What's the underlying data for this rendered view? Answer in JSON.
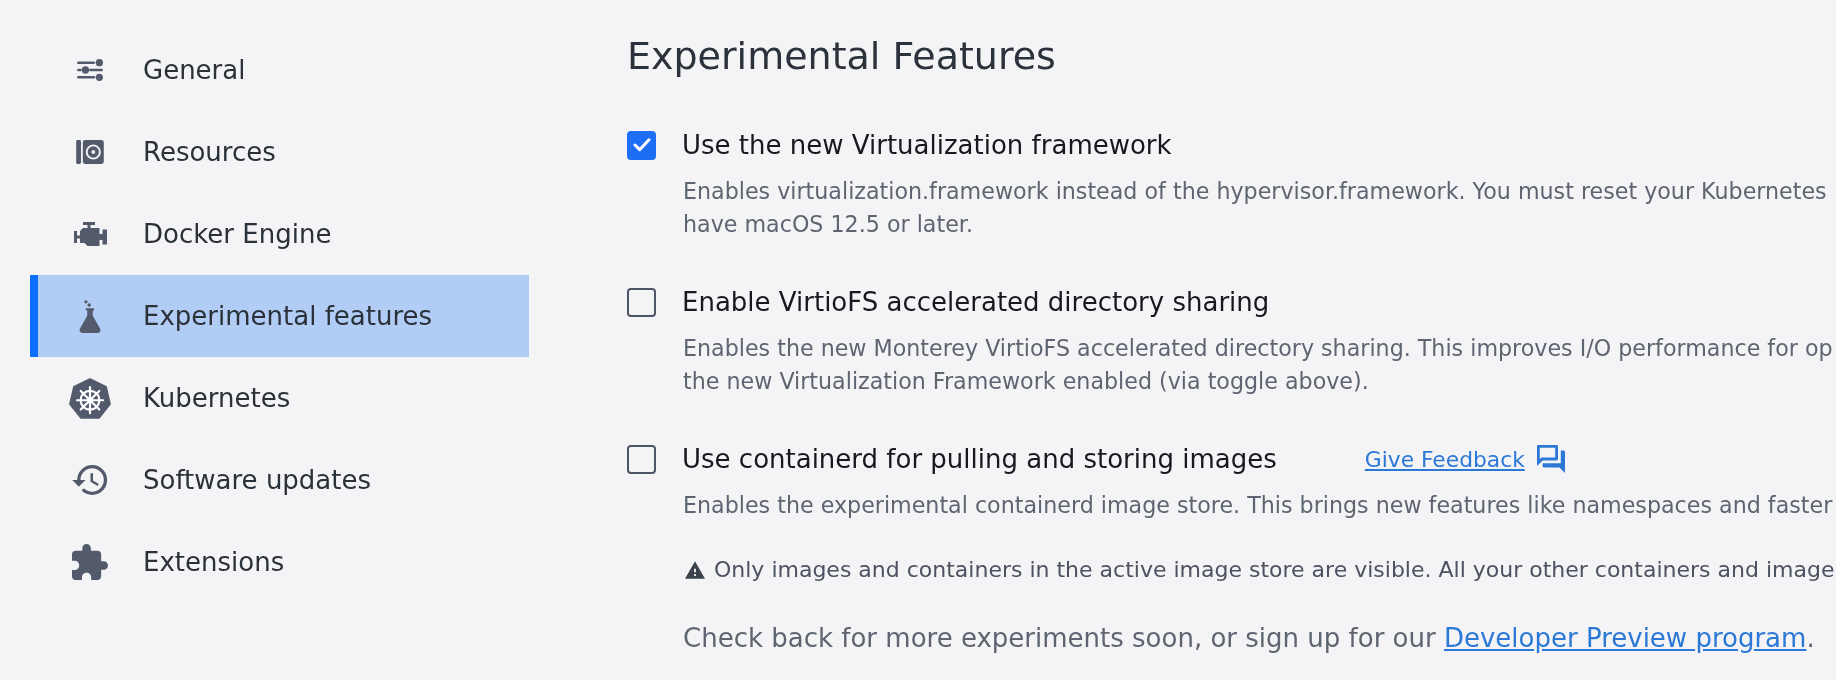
{
  "sidebar": {
    "items": [
      {
        "label": "General",
        "selected": false
      },
      {
        "label": "Resources",
        "selected": false
      },
      {
        "label": "Docker Engine",
        "selected": false
      },
      {
        "label": "Experimental features",
        "selected": true
      },
      {
        "label": "Kubernetes",
        "selected": false
      },
      {
        "label": "Software updates",
        "selected": false
      },
      {
        "label": "Extensions",
        "selected": false
      }
    ]
  },
  "main": {
    "title": "Experimental Features",
    "features": [
      {
        "label": "Use the new Virtualization framework",
        "checked": true,
        "description": [
          "Enables virtualization.framework instead of the hypervisor.framework. You must reset your Kubernetes",
          "have macOS 12.5 or later."
        ]
      },
      {
        "label": "Enable VirtioFS accelerated directory sharing",
        "checked": false,
        "description": [
          "Enables the new Monterey VirtioFS accelerated directory sharing. This improves I/O performance for op",
          "the new Virtualization Framework enabled (via toggle above)."
        ]
      },
      {
        "label": "Use containerd for pulling and storing images",
        "checked": false,
        "feedback_link": "Give Feedback",
        "description": [
          "Enables the experimental containerd image store. This brings new features like namespaces and faster"
        ],
        "warning": "Only images and containers in the active image store are visible. All your other containers and image"
      }
    ],
    "footer": {
      "text": "Check back for more experiments soon, or sign up for our",
      "link": "Developer Preview program",
      "end": "."
    }
  }
}
